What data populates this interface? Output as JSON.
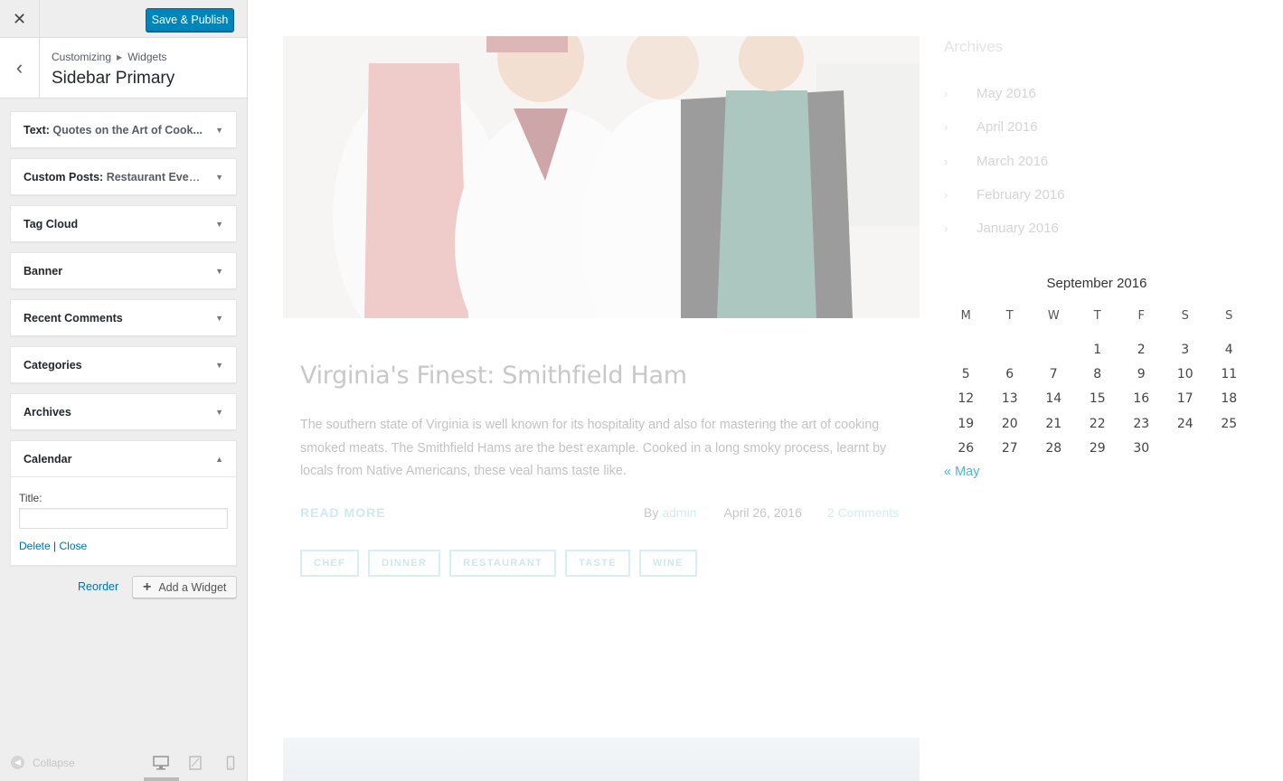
{
  "panel": {
    "close_icon": "close-icon",
    "publish_label": "Save & Publish",
    "breadcrumb": [
      "Customizing",
      "Widgets"
    ],
    "section_title": "Sidebar Primary",
    "widgets": [
      {
        "type": "Text",
        "name": "Quotes on the Art of Cook..."
      },
      {
        "type": "Custom Posts",
        "name": "Restaurant Events"
      },
      {
        "type": "Tag Cloud",
        "name": ""
      },
      {
        "type": "Banner",
        "name": ""
      },
      {
        "type": "Recent Comments",
        "name": ""
      },
      {
        "type": "Categories",
        "name": ""
      },
      {
        "type": "Archives",
        "name": ""
      },
      {
        "type": "Calendar",
        "name": "",
        "expanded": true
      }
    ],
    "calendar_widget": {
      "title_label": "Title:",
      "title_value": "",
      "delete_label": "Delete",
      "separator": "|",
      "close_label": "Close"
    },
    "reorder_label": "Reorder",
    "add_widget_label": "Add a Widget",
    "collapse_label": "Collapse",
    "devices": [
      "desktop-icon",
      "tablet-icon",
      "mobile-icon"
    ],
    "active_device": "desktop"
  },
  "preview": {
    "post": {
      "title": "Virginia's Finest: Smithfield Ham",
      "excerpt": "The southern state of Virginia is well known for its hospitality and also for mastering the art of cooking smoked meats. The Smithfield Hams are the best example. Cooked in a long smoky process, learnt by locals from Native Americans, these veal hams taste like.",
      "read_more": "READ MORE",
      "by": "By",
      "author": "admin",
      "date": "April 26, 2016",
      "comments": "2 Comments",
      "tags": [
        "CHEF",
        "DINNER",
        "RESTAURANT",
        "TASTE",
        "WINE"
      ]
    },
    "archives": {
      "heading": "Archives",
      "items": [
        "May 2016",
        "April 2016",
        "March 2016",
        "February 2016",
        "January 2016"
      ]
    },
    "calendar": {
      "caption": "September 2016",
      "weekdays": [
        "M",
        "T",
        "W",
        "T",
        "F",
        "S",
        "S"
      ],
      "weeks": [
        [
          "",
          "",
          "",
          "1",
          "2",
          "3",
          "4"
        ],
        [
          "5",
          "6",
          "7",
          "8",
          "9",
          "10",
          "11"
        ],
        [
          "12",
          "13",
          "14",
          "15",
          "16",
          "17",
          "18"
        ],
        [
          "19",
          "20",
          "21",
          "22",
          "23",
          "24",
          "25"
        ],
        [
          "26",
          "27",
          "28",
          "29",
          "30",
          "",
          ""
        ]
      ],
      "prev_link": "« May"
    }
  },
  "colors": {
    "publish_button": "#0085ba",
    "link": "#0073aa",
    "accent_light": "#4fb5cf"
  }
}
